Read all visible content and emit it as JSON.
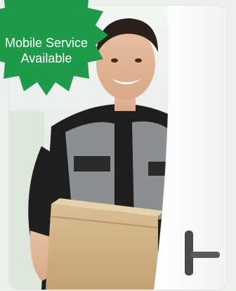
{
  "badge": {
    "line1": "Mobile Service",
    "line2": "Available",
    "color": "#1f9a4a",
    "icon": "delivery-van-icon"
  },
  "photo": {
    "subject": "delivery-person-with-box"
  }
}
